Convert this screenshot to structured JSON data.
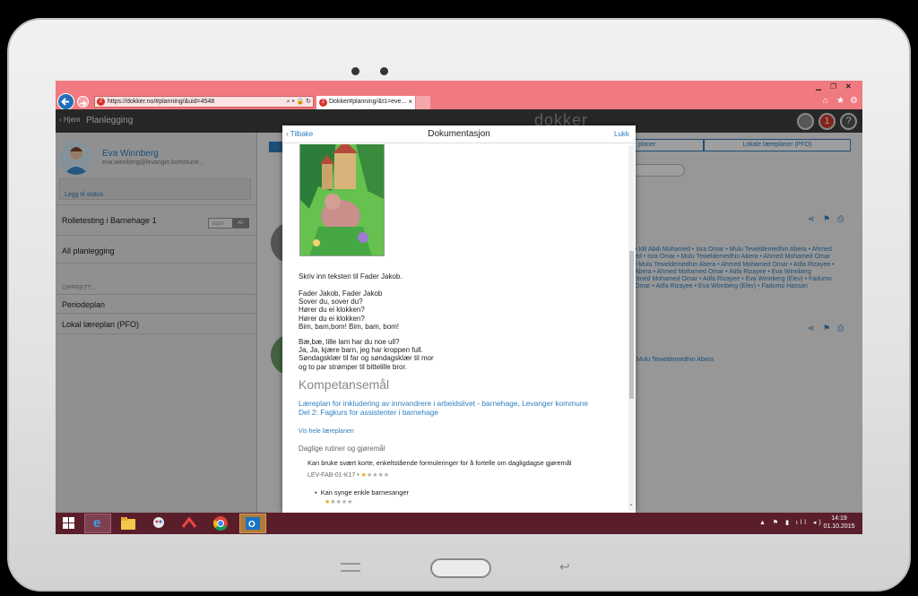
{
  "browser": {
    "url": "https://dokker.no/#planning/&uid=4548",
    "tab_label": "Dokker#planning/&t1=eve...",
    "tab_badge": "2",
    "url_badge": "2",
    "tab_close": "×"
  },
  "app": {
    "back_label": "Hjem",
    "section_title": "Planlegging",
    "logo_text": "dokker",
    "notif_count": "1"
  },
  "user": {
    "name": "Eva Winnberg",
    "email": "eva.winnberg@levanger.kommune...",
    "status_link": "Legg til status"
  },
  "sidebar": {
    "role_label": "Rolletesting i Barnehage 1",
    "toggle_off": "ELEV",
    "toggle_on": "AV",
    "all_planning": "All planlegging",
    "create_heading": "OPPRETT...",
    "items": [
      {
        "label": "Periodeplan"
      },
      {
        "label": "Lokal læreplan (PFO)"
      }
    ]
  },
  "background": {
    "tab_plans": "planer",
    "tab_local": "Lokale læreplaner (PFO)",
    "names_block": [
      "• Idil Abdi Mohamed • Isra Omar • Mulu Teweldemedhin Abera • Ahmed",
      "ed • Isra Omar • Mulu Teweldemedhin Abera • Ahmed Mohamed Omar",
      "• Mulu Teweldemedhin Abera • Ahmed Mohamed Omar • Atifa Rizayee •",
      "Abera • Ahmed Mohamed Omar • Atifa Rizayee • Eva Winnberg",
      "hmed Mohamed Omar • Atifa Rizayee • Eva Winnberg (Elev) • Fadumo",
      "Omar • Atifa Rizayee • Eva Winnberg (Elev) • Fadumo Hassan"
    ],
    "name_single": "Mulu Teweldemedhin Abera"
  },
  "modal": {
    "back_label": "Tilbake",
    "title": "Dokumentasjon",
    "close_label": "Lukk",
    "intro": "Skriv inn teksten til Fader Jakob.",
    "verse1": [
      "Fader Jakob, Fader Jakob",
      "Sover du, sover du?",
      "Hører du ei klokken?",
      "Hører du ei klokken?",
      "Bim, bam,bom! Bim, bam, bom!"
    ],
    "verse2": [
      "Bæ,bæ, lille lam har du noe ull?",
      "Ja, Ja, kjære barn, jeg har kroppen full.",
      "Søndagsklær til far og søndagsklær til mor",
      "og to par strømper til bittelille bror."
    ],
    "competence_heading": "Kompetansemål",
    "curriculum_link": [
      "Læreplan for inkludering av innvandrere i arbeidslivet - barnehage, Levanger kommune",
      "Del 2: Fagkurs for assistenter i barnehage"
    ],
    "show_plan_link": "Vis hele læreplanen",
    "goal_heading": "Daglige rutiner og gjøremål",
    "goal_text": "Kan bruke svært korte, enkeltstående formuleringer for å fortelle om dagligdagse gjøremål",
    "goal_code": "LEV-FAB-01-K17 •",
    "goal_rating": 1,
    "sub_item": "Kan synge enkle barnesanger",
    "sub_rating": 1
  },
  "taskbar": {
    "time": "14:19",
    "date": "01.10.2015"
  },
  "colors": {
    "browser_bar": "#f07a80",
    "app_bar": "#3f3f3f",
    "link_blue": "#2e7fc0",
    "taskbar": "#5a1e2b",
    "star_active": "#f2a400"
  }
}
